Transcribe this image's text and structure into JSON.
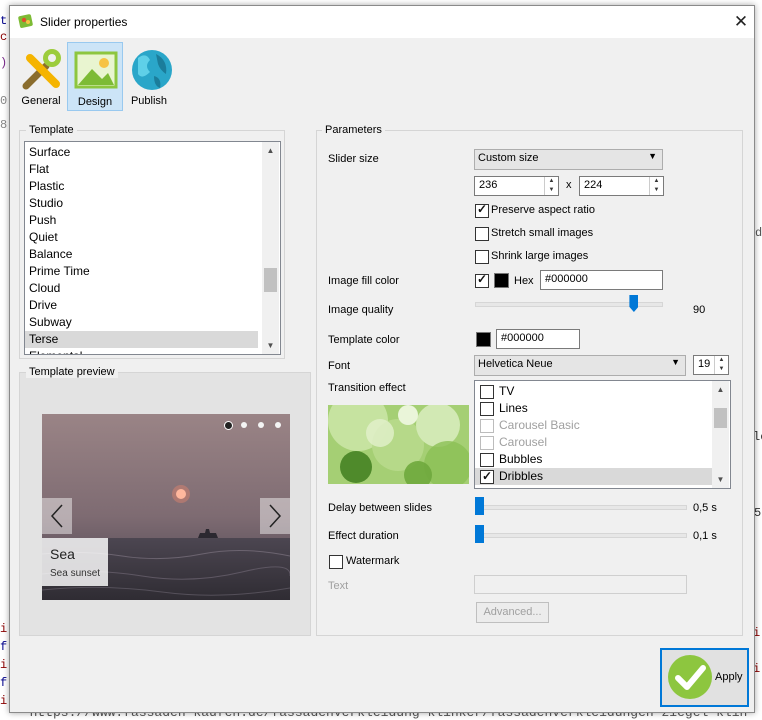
{
  "background_editor": {
    "left_fragments": [
      "t",
      "c",
      ")",
      "0.0",
      "8",
      "f",
      "f",
      "f",
      "f",
      "i",
      "f",
      "i",
      "f",
      "i",
      "f"
    ],
    "bottom_url": "- https://www.fassaden-kaufen.de/fassadenverkleidung-klinker/fassadenverkleidungen-ziegel-klin",
    "right_fragments": [
      "d",
      "le",
      "ul",
      "i-",
      "i-",
      "i-",
      "i-",
      "i-",
      "5"
    ]
  },
  "dialog": {
    "title": "Slider properties",
    "close_symbol": "✕",
    "tabs": [
      {
        "label": "General",
        "icon": "wrench-icon"
      },
      {
        "label": "Design",
        "icon": "picture-icon",
        "active": true
      },
      {
        "label": "Publish",
        "icon": "globe-icon"
      }
    ]
  },
  "template": {
    "group_title": "Template",
    "items": [
      "Surface",
      "Flat",
      "Plastic",
      "Studio",
      "Push",
      "Quiet",
      "Balance",
      "Prime Time",
      "Cloud",
      "Drive",
      "Subway",
      "Terse",
      "Elemental"
    ],
    "selected": "Terse"
  },
  "preview": {
    "group_title": "Template preview",
    "caption_title": "Sea",
    "caption_sub": "Sea sunset",
    "dots": 4,
    "active_dot": 1
  },
  "parameters": {
    "group_title": "Parameters",
    "slider_size_label": "Slider size",
    "slider_size_value": "Custom size",
    "width": "236",
    "x_sep": "x",
    "height": "224",
    "preserve_aspect": {
      "label": "Preserve aspect ratio",
      "checked": true
    },
    "stretch_small": {
      "label": "Stretch small images",
      "checked": false
    },
    "shrink_large": {
      "label": "Shrink large images",
      "checked": false
    },
    "image_fill_label": "Image fill color",
    "hex_label": "Hex",
    "fill_hex": "#000000",
    "image_quality_label": "Image quality",
    "image_quality": 90,
    "image_quality_text": "90",
    "template_color_label": "Template color",
    "template_color_hex": "#000000",
    "font_label": "Font",
    "font_value": "Helvetica Neue",
    "font_size": "19",
    "transition_label": "Transition effect",
    "transitions": [
      {
        "label": "TV",
        "checked": false,
        "enabled": true
      },
      {
        "label": "Lines",
        "checked": false,
        "enabled": true
      },
      {
        "label": "Carousel Basic",
        "checked": false,
        "enabled": false
      },
      {
        "label": "Carousel",
        "checked": false,
        "enabled": false
      },
      {
        "label": "Bubbles",
        "checked": false,
        "enabled": true
      },
      {
        "label": "Dribbles",
        "checked": true,
        "enabled": true
      }
    ],
    "delay_label": "Delay between slides",
    "delay_value": "0,5 s",
    "duration_label": "Effect duration",
    "duration_value": "0,1 s",
    "watermark_label": "Watermark",
    "text_label": "Text",
    "advanced_label": "Advanced..."
  },
  "apply_label": "Apply",
  "colors": {
    "accent": "#0078d7",
    "selection": "#cce4f7",
    "apply_green": "#8dc63f"
  }
}
